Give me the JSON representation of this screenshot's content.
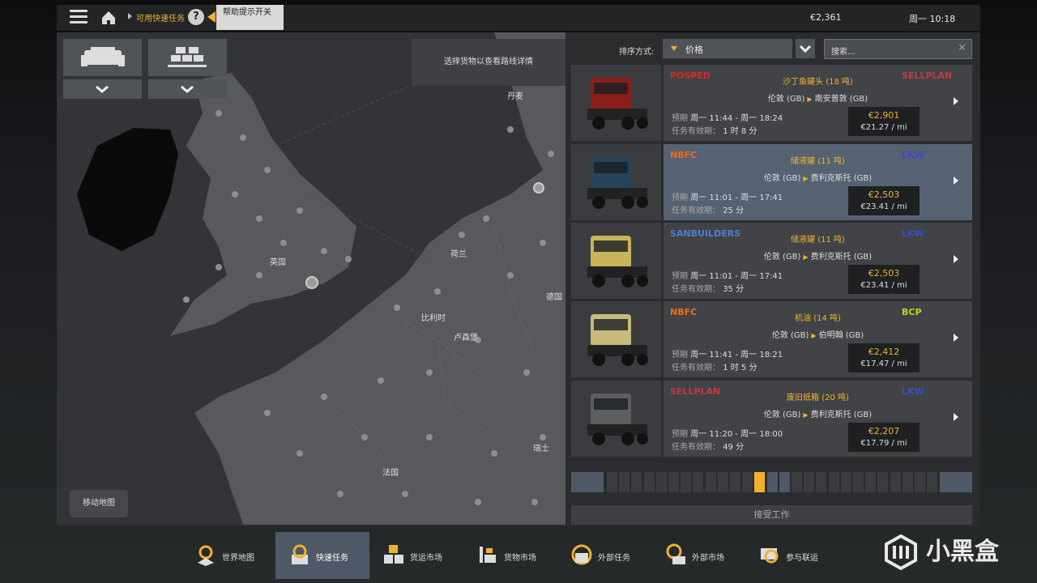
{
  "topbar": {
    "breadcrumb": "可用快速任务",
    "help_symbol": "?",
    "tooltip": "帮助提示开关",
    "money": "€2,361",
    "time": "周一 10:18"
  },
  "map": {
    "hint": "选择货物以查看路线详情",
    "move_button": "移动地图",
    "labels": {
      "denmark": "丹麦",
      "uk": "英国",
      "netherlands": "荷兰",
      "germany": "德国",
      "belgium": "比利时",
      "luxembourg": "卢森堡",
      "switzerland": "瑞士",
      "france": "法国"
    }
  },
  "sort": {
    "label": "排序方式:",
    "value": "价格",
    "search_placeholder": "搜索..."
  },
  "jobs": [
    {
      "truck_color": "#8b1e1a",
      "logo_left": "POSPED",
      "logo_left_color": "#d42a2a",
      "logo_right": "SELLPLAN",
      "logo_right_color": "#c63b3b",
      "cargo": "沙丁鱼罐头 (18 吨)",
      "origin": "伦敦 (GB)",
      "destination": "南安普敦 (GB)",
      "eta_label": "预期",
      "eta": "周一 11:44 - 周一 18:24",
      "valid_label": "任务有效期：",
      "valid": "1 时 8 分",
      "price": "€2,901",
      "per_mile": "€21.27 / mi"
    },
    {
      "truck_color": "#26435a",
      "logo_left": "NBFC",
      "logo_left_color": "#f06a1a",
      "logo_right": "LKW",
      "logo_right_color": "#3a4bc7",
      "cargo": "储液罐 (11 吨)",
      "origin": "伦敦 (GB)",
      "destination": "费利克斯托 (GB)",
      "eta_label": "预期",
      "eta": "周一 11:01 - 周一 17:41",
      "valid_label": "任务有效期：",
      "valid": "25 分",
      "price": "€2,503",
      "per_mile": "€23.41 / mi"
    },
    {
      "truck_color": "#c8b45a",
      "logo_left": "SANBUILDERS",
      "logo_left_color": "#4a7fd1",
      "logo_right": "LKW",
      "logo_right_color": "#3a4bc7",
      "cargo": "储液罐 (11 吨)",
      "origin": "伦敦 (GB)",
      "destination": "费利克斯托 (GB)",
      "eta_label": "预期",
      "eta": "周一 11:01 - 周一 17:41",
      "valid_label": "任务有效期：",
      "valid": "35 分",
      "price": "€2,503",
      "per_mile": "€23.41 / mi"
    },
    {
      "truck_color": "#c9bb7c",
      "logo_left": "NBFC",
      "logo_left_color": "#f06a1a",
      "logo_right": "BCP",
      "logo_right_color": "#b5d91e",
      "cargo": "机油 (14 吨)",
      "origin": "伦敦 (GB)",
      "destination": "伯明翰 (GB)",
      "eta_label": "预期",
      "eta": "周一 11:41 - 周一 18:21",
      "valid_label": "任务有效期：",
      "valid": "1 时 5 分",
      "price": "€2,412",
      "per_mile": "€17.47 / mi"
    },
    {
      "truck_color": "#5d5e60",
      "logo_left": "SELLPLAN",
      "logo_left_color": "#c63b3b",
      "logo_right": "LKW",
      "logo_right_color": "#3a4bc7",
      "cargo": "废旧纸箱 (20 吨)",
      "origin": "伦敦 (GB)",
      "destination": "费利克斯托 (GB)",
      "eta_label": "预期",
      "eta": "周一 11:20 - 周一 18:00",
      "valid_label": "任务有效期：",
      "valid": "49 分",
      "price": "€2,207",
      "per_mile": "€17.79 / mi"
    }
  ],
  "accept_button": "接受工作",
  "tabs": [
    {
      "label": "世界地图",
      "icon": "world-map-icon"
    },
    {
      "label": "快速任务",
      "icon": "quick-job-icon",
      "active": true
    },
    {
      "label": "货运市场",
      "icon": "freight-market-icon"
    },
    {
      "label": "货物市场",
      "icon": "cargo-market-icon"
    },
    {
      "label": "外部任务",
      "icon": "external-jobs-icon"
    },
    {
      "label": "外部市场",
      "icon": "external-market-icon"
    },
    {
      "label": "参与联运",
      "icon": "convoy-icon"
    }
  ],
  "watermark": "小黑盒",
  "colors": {
    "accent": "#f1b12c",
    "selected": "#566271"
  }
}
